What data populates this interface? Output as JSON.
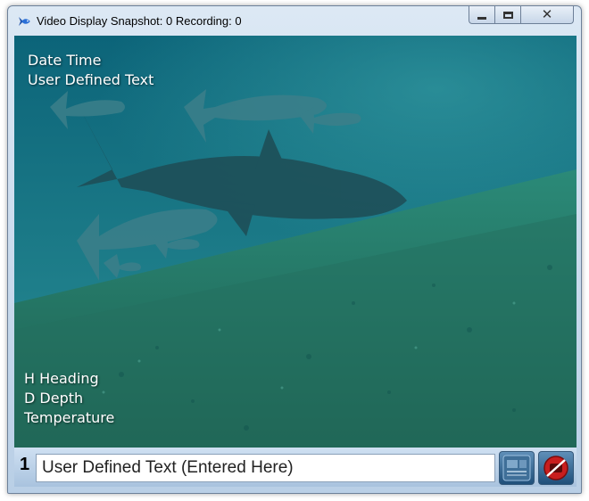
{
  "window": {
    "title": "Video Display Snapshot: 0 Recording: 0",
    "close_glyph": "✕"
  },
  "overlay": {
    "top_line1": "Date Time",
    "top_line2": "User Defined Text",
    "bottom_line1": "H Heading",
    "bottom_line2": "D Depth",
    "bottom_line3": "Temperature"
  },
  "bottombar": {
    "channel_number": "1",
    "user_text_value": "User Defined Text (Entered Here)"
  },
  "icons": {
    "app": "fish-icon",
    "snapshot": "snapshot-settings-icon",
    "record": "record-disabled-icon"
  }
}
